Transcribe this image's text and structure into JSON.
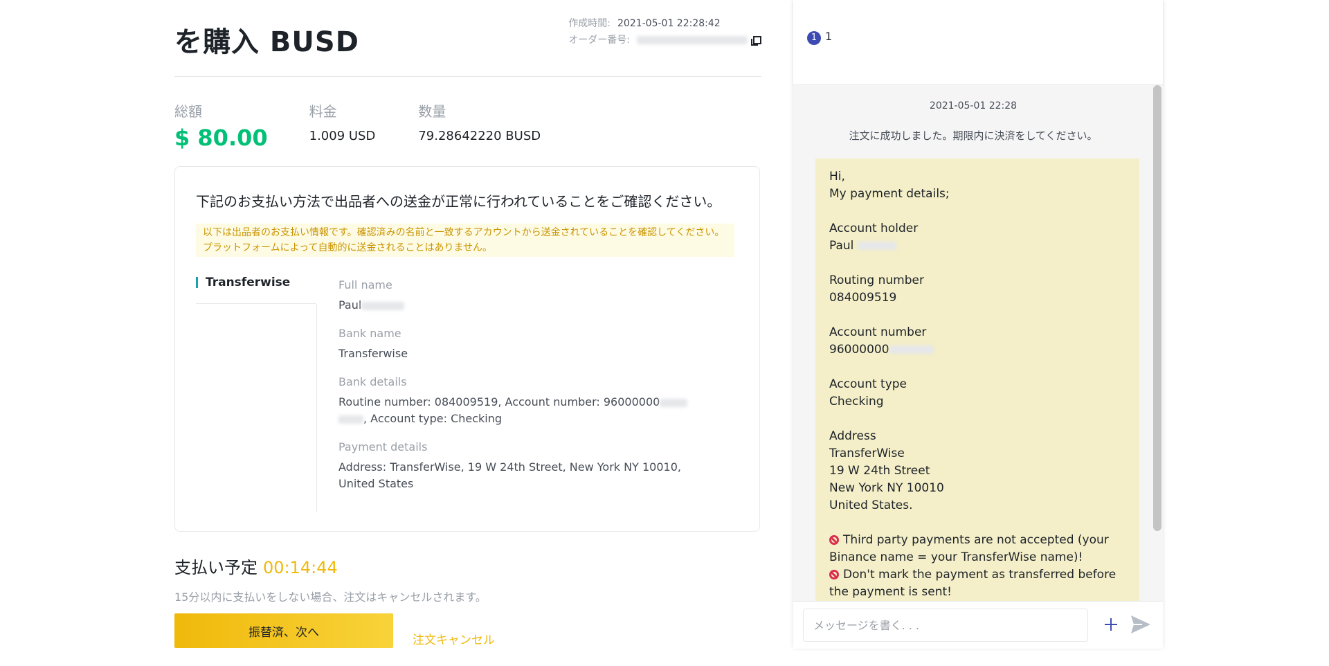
{
  "header": {
    "title": "を購入 BUSD",
    "created_label": "作成時間:",
    "created_value": "2021-05-01 22:28:42",
    "order_label": "オーダー番号:"
  },
  "amounts": {
    "total_label": "総額",
    "total_value": "$ 80.00",
    "fee_label": "料金",
    "fee_value": "1.009 USD",
    "qty_label": "数量",
    "qty_value": "79.28642220 BUSD"
  },
  "payment_card": {
    "notice": "下記のお支払い方法で出品者への送金が正常に行われていることをご確認ください。",
    "warning": "以下は出品者のお支払い情報です。確認済みの名前と一致するアカウントから送金されていることを確認してください。プラットフォームによって自動的に送金されることはありません。",
    "method_tab": "Transferwise",
    "fields": {
      "full_name_label": "Full name",
      "full_name_value": "Paul",
      "bank_name_label": "Bank name",
      "bank_name_value": "Transferwise",
      "bank_details_label": "Bank details",
      "bank_details_value_a": "Routine number: 084009519, Account number: 96000000",
      "bank_details_value_b": ", Account type: Checking",
      "payment_details_label": "Payment details",
      "payment_details_value": "Address: TransferWise, 19 W 24th Street, New York NY 10010, United States"
    }
  },
  "payment_due": {
    "title": "支払い予定",
    "timer": "00:14:44",
    "subtext": "15分以内に支払いをしない場合、注文はキャンセルされます。",
    "confirm_button": "振替済、次へ",
    "cancel_link": "注文キャンセル"
  },
  "chat": {
    "badge": "1",
    "count": "1",
    "date": "2021-05-01 22:28",
    "system_message": "注文に成功しました。期限内に決済をしてください。",
    "message": {
      "line1": "Hi,",
      "line2": "My payment details;",
      "holder_label": "Account holder",
      "holder_value": "Paul",
      "routing_label": "Routing number",
      "routing_value": "084009519",
      "account_label": "Account number",
      "account_value": "96000000",
      "type_label": "Account type",
      "type_value": "Checking",
      "address_label": "Address",
      "address_1": "TransferWise",
      "address_2": "19 W 24th Street",
      "address_3": "New York NY 10010",
      "address_4": "United States.",
      "warn_1": "Third party payments are not accepted (your Binance name = your TransferWise name)!",
      "warn_2": "Don't mark the payment as transferred before the payment is sent!"
    },
    "input_placeholder": "メッセージを書く. . ."
  },
  "colors": {
    "accent_yellow": "#f0b90b",
    "total_green": "#02c076",
    "badge_blue": "#3e4bb3",
    "bubble_bg": "#f4efc8"
  }
}
